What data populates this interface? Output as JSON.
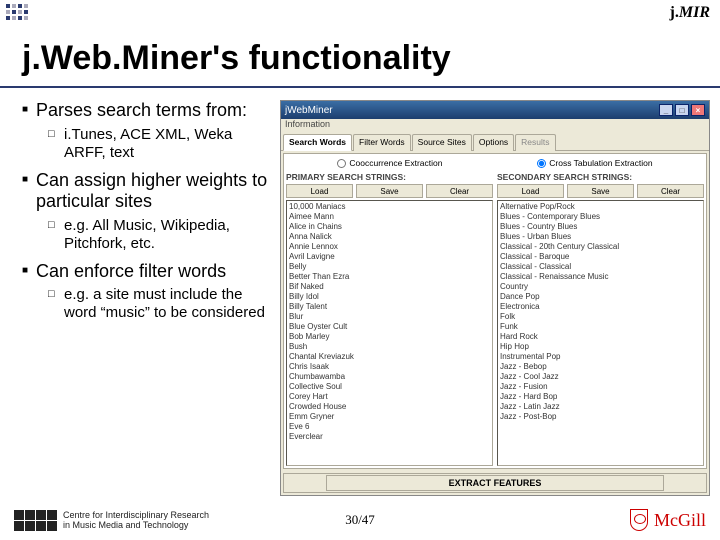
{
  "header": {
    "logo_text": "j.MIR"
  },
  "title": "j.Web.Miner's functionality",
  "bullets": [
    {
      "text": "Parses search terms from:",
      "sub": [
        {
          "text": "i.Tunes, ACE XML, Weka ARFF, text"
        }
      ]
    },
    {
      "text": "Can assign higher weights to particular sites",
      "sub": [
        {
          "text": "e.g. All Music, Wikipedia, Pitchfork, etc."
        }
      ]
    },
    {
      "text": "Can enforce filter words",
      "sub": [
        {
          "text": "e.g. a site must include the word “music” to be considered"
        }
      ]
    }
  ],
  "app": {
    "title": "jWebMiner",
    "menu": "Information",
    "tabs": [
      "Search Words",
      "Filter Words",
      "Source Sites",
      "Options",
      "Results"
    ],
    "radio1": "Cooccurrence Extraction",
    "radio2": "Cross Tabulation Extraction",
    "colA": {
      "header": "PRIMARY SEARCH STRINGS:",
      "load": "Load",
      "save": "Save",
      "clear": "Clear",
      "items": [
        "10,000 Maniacs",
        "Aimee Mann",
        "Alice in Chains",
        "Anna Nalick",
        "Annie Lennox",
        "Avril Lavigne",
        "Belly",
        "Better Than Ezra",
        "Bif Naked",
        "Billy Idol",
        "Billy Talent",
        "Blur",
        "Blue Oyster Cult",
        "Bob Marley",
        "Bush",
        "Chantal Kreviazuk",
        "Chris Isaak",
        "Chumbawamba",
        "Collective Soul",
        "Corey Hart",
        "Crowded House",
        "Emm Gryner",
        "Eve 6",
        "Everclear"
      ]
    },
    "colB": {
      "header": "SECONDARY SEARCH STRINGS:",
      "load": "Load",
      "save": "Save",
      "clear": "Clear",
      "items": [
        "Alternative Pop/Rock",
        "Blues - Contemporary Blues",
        "Blues - Country Blues",
        "Blues - Urban Blues",
        "Classical - 20th Century Classical",
        "Classical - Baroque",
        "Classical - Classical",
        "Classical - Renaissance Music",
        "Country",
        "Dance Pop",
        "Electronica",
        "Folk",
        "Funk",
        "Hard Rock",
        "Hip Hop",
        "Instrumental Pop",
        "Jazz - Bebop",
        "Jazz - Cool Jazz",
        "Jazz - Fusion",
        "Jazz - Hard Bop",
        "Jazz - Latin Jazz",
        "Jazz - Post-Bop"
      ]
    },
    "extract": "EXTRACT FEATURES"
  },
  "footer": {
    "cirmmt_line1": "Centre for Interdisciplinary Research",
    "cirmmt_line2": "in Music Media and Technology",
    "page": "30/47",
    "mcgill": "McGill"
  }
}
